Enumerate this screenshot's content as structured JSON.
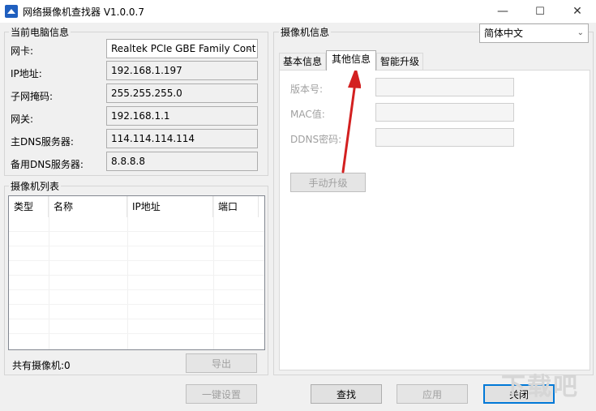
{
  "window": {
    "title": "网络摄像机查找器 V1.0.0.7",
    "controls": {
      "minimize": "—",
      "maximize": "☐",
      "close": "✕"
    }
  },
  "pc_info": {
    "group_label": "当前电脑信息",
    "nic_label": "网卡:",
    "nic_value": "Realtek PCIe GBE Family Cont",
    "ip_label": "IP地址:",
    "ip_value": "192.168.1.197",
    "mask_label": "子网掩码:",
    "mask_value": "255.255.255.0",
    "gateway_label": "网关:",
    "gateway_value": "192.168.1.1",
    "dns1_label": "主DNS服务器:",
    "dns1_value": "114.114.114.114",
    "dns2_label": "备用DNS服务器:",
    "dns2_value": "8.8.8.8"
  },
  "camera_list": {
    "group_label": "摄像机列表",
    "columns": [
      "类型",
      "名称",
      "IP地址",
      "端口"
    ],
    "rows": [],
    "total_label": "共有摄像机:0",
    "export_label": "导出"
  },
  "camera_info": {
    "group_label": "摄像机信息",
    "language_value": "简体中文",
    "tabs": [
      "基本信息",
      "其他信息",
      "智能升级"
    ],
    "active_tab": 1,
    "version_label": "版本号:",
    "mac_label": "MAC值:",
    "ddns_label": "DDNS密码:",
    "upgrade_label": "手动升级"
  },
  "bottom_buttons": {
    "oneclick": "一键设置",
    "search": "查找",
    "apply": "应用",
    "close": "关闭"
  },
  "colors": {
    "arrow": "#d32020",
    "accent": "#0078d7"
  },
  "watermark": "下载吧"
}
